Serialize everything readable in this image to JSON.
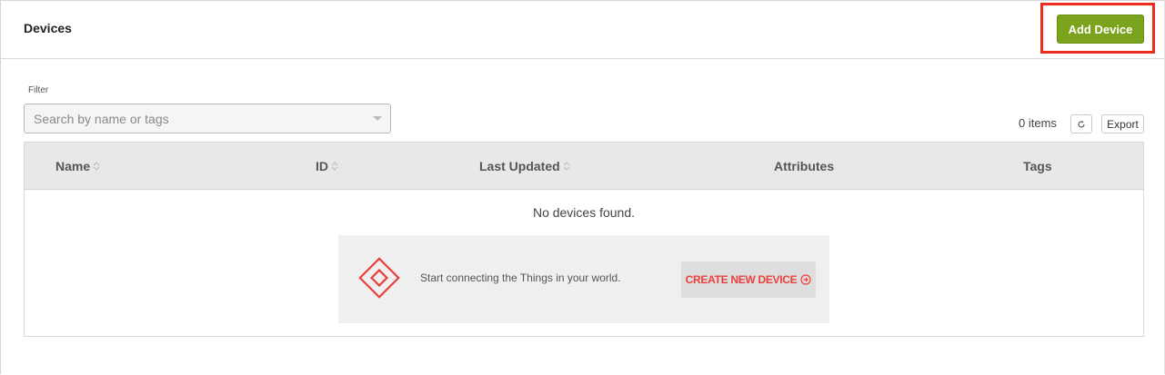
{
  "header": {
    "title": "Devices",
    "add_button_label": "Add Device"
  },
  "filter": {
    "label": "Filter",
    "placeholder": "Search by name or tags"
  },
  "toolbar": {
    "items_count": "0 items",
    "refresh_icon": "refresh-icon",
    "export_label": "Export"
  },
  "table": {
    "columns": [
      "Name",
      "ID",
      "Last Updated",
      "Attributes",
      "Tags"
    ],
    "sortable": [
      true,
      true,
      true,
      false,
      false
    ],
    "empty_message": "No devices found."
  },
  "promo": {
    "logo_icon": "diamond-logo-icon",
    "text": "Start connecting the Things in your world.",
    "button_label": "CREATE NEW DEVICE"
  },
  "colors": {
    "accent_green": "#7ba31b",
    "highlight_red": "#ee2c1d",
    "brand_red": "#e8413d"
  }
}
